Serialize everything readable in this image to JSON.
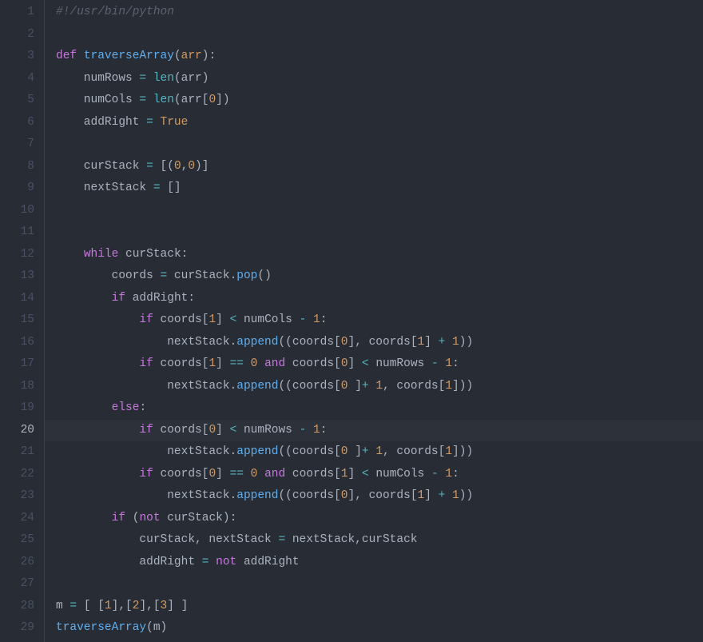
{
  "editor": {
    "active_line": 20,
    "lines": [
      {
        "n": 1,
        "tokens": [
          [
            "c-comment",
            "#!/usr/bin/python"
          ]
        ]
      },
      {
        "n": 2,
        "tokens": []
      },
      {
        "n": 3,
        "tokens": [
          [
            "c-keyword",
            "def"
          ],
          [
            "c-ident",
            " "
          ],
          [
            "c-def",
            "traverseArray"
          ],
          [
            "c-punc",
            "("
          ],
          [
            "c-param",
            "arr"
          ],
          [
            "c-punc",
            ")"
          ],
          [
            "c-punc",
            ":"
          ]
        ]
      },
      {
        "n": 4,
        "tokens": [
          [
            "c-ident",
            "    numRows "
          ],
          [
            "c-op",
            "="
          ],
          [
            "c-ident",
            " "
          ],
          [
            "c-builtin",
            "len"
          ],
          [
            "c-punc",
            "("
          ],
          [
            "c-ident",
            "arr"
          ],
          [
            "c-punc",
            ")"
          ]
        ]
      },
      {
        "n": 5,
        "tokens": [
          [
            "c-ident",
            "    numCols "
          ],
          [
            "c-op",
            "="
          ],
          [
            "c-ident",
            " "
          ],
          [
            "c-builtin",
            "len"
          ],
          [
            "c-punc",
            "("
          ],
          [
            "c-ident",
            "arr"
          ],
          [
            "c-punc",
            "["
          ],
          [
            "c-num",
            "0"
          ],
          [
            "c-punc",
            "]"
          ],
          [
            "c-punc",
            ")"
          ]
        ]
      },
      {
        "n": 6,
        "tokens": [
          [
            "c-ident",
            "    addRight "
          ],
          [
            "c-op",
            "="
          ],
          [
            "c-ident",
            " "
          ],
          [
            "c-bool",
            "True"
          ]
        ]
      },
      {
        "n": 7,
        "tokens": []
      },
      {
        "n": 8,
        "tokens": [
          [
            "c-ident",
            "    curStack "
          ],
          [
            "c-op",
            "="
          ],
          [
            "c-ident",
            " "
          ],
          [
            "c-punc",
            "[("
          ],
          [
            "c-num",
            "0"
          ],
          [
            "c-punc",
            ","
          ],
          [
            "c-num",
            "0"
          ],
          [
            "c-punc",
            ")]"
          ]
        ]
      },
      {
        "n": 9,
        "tokens": [
          [
            "c-ident",
            "    nextStack "
          ],
          [
            "c-op",
            "="
          ],
          [
            "c-ident",
            " "
          ],
          [
            "c-punc",
            "[]"
          ]
        ]
      },
      {
        "n": 10,
        "tokens": []
      },
      {
        "n": 11,
        "tokens": []
      },
      {
        "n": 12,
        "tokens": [
          [
            "c-ident",
            "    "
          ],
          [
            "c-keyword",
            "while"
          ],
          [
            "c-ident",
            " curStack"
          ],
          [
            "c-punc",
            ":"
          ]
        ]
      },
      {
        "n": 13,
        "tokens": [
          [
            "c-ident",
            "        coords "
          ],
          [
            "c-op",
            "="
          ],
          [
            "c-ident",
            " curStack"
          ],
          [
            "c-punc",
            "."
          ],
          [
            "c-func",
            "pop"
          ],
          [
            "c-punc",
            "()"
          ]
        ]
      },
      {
        "n": 14,
        "tokens": [
          [
            "c-ident",
            "        "
          ],
          [
            "c-keyword",
            "if"
          ],
          [
            "c-ident",
            " addRight"
          ],
          [
            "c-punc",
            ":"
          ]
        ]
      },
      {
        "n": 15,
        "tokens": [
          [
            "c-ident",
            "            "
          ],
          [
            "c-keyword",
            "if"
          ],
          [
            "c-ident",
            " coords"
          ],
          [
            "c-punc",
            "["
          ],
          [
            "c-num",
            "1"
          ],
          [
            "c-punc",
            "]"
          ],
          [
            "c-ident",
            " "
          ],
          [
            "c-op",
            "<"
          ],
          [
            "c-ident",
            " numCols "
          ],
          [
            "c-op",
            "-"
          ],
          [
            "c-ident",
            " "
          ],
          [
            "c-num",
            "1"
          ],
          [
            "c-punc",
            ":"
          ]
        ]
      },
      {
        "n": 16,
        "tokens": [
          [
            "c-ident",
            "                nextStack"
          ],
          [
            "c-punc",
            "."
          ],
          [
            "c-func",
            "append"
          ],
          [
            "c-punc",
            "(("
          ],
          [
            "c-ident",
            "coords"
          ],
          [
            "c-punc",
            "["
          ],
          [
            "c-num",
            "0"
          ],
          [
            "c-punc",
            "]"
          ],
          [
            "c-punc",
            ", "
          ],
          [
            "c-ident",
            "coords"
          ],
          [
            "c-punc",
            "["
          ],
          [
            "c-num",
            "1"
          ],
          [
            "c-punc",
            "]"
          ],
          [
            "c-ident",
            " "
          ],
          [
            "c-op",
            "+"
          ],
          [
            "c-ident",
            " "
          ],
          [
            "c-num",
            "1"
          ],
          [
            "c-punc",
            "))"
          ]
        ]
      },
      {
        "n": 17,
        "tokens": [
          [
            "c-ident",
            "            "
          ],
          [
            "c-keyword",
            "if"
          ],
          [
            "c-ident",
            " coords"
          ],
          [
            "c-punc",
            "["
          ],
          [
            "c-num",
            "1"
          ],
          [
            "c-punc",
            "]"
          ],
          [
            "c-ident",
            " "
          ],
          [
            "c-op",
            "=="
          ],
          [
            "c-ident",
            " "
          ],
          [
            "c-num",
            "0"
          ],
          [
            "c-ident",
            " "
          ],
          [
            "c-keyword",
            "and"
          ],
          [
            "c-ident",
            " coords"
          ],
          [
            "c-punc",
            "["
          ],
          [
            "c-num",
            "0"
          ],
          [
            "c-punc",
            "]"
          ],
          [
            "c-ident",
            " "
          ],
          [
            "c-op",
            "<"
          ],
          [
            "c-ident",
            " numRows "
          ],
          [
            "c-op",
            "-"
          ],
          [
            "c-ident",
            " "
          ],
          [
            "c-num",
            "1"
          ],
          [
            "c-punc",
            ":"
          ]
        ]
      },
      {
        "n": 18,
        "tokens": [
          [
            "c-ident",
            "                nextStack"
          ],
          [
            "c-punc",
            "."
          ],
          [
            "c-func",
            "append"
          ],
          [
            "c-punc",
            "(("
          ],
          [
            "c-ident",
            "coords"
          ],
          [
            "c-punc",
            "["
          ],
          [
            "c-num",
            "0"
          ],
          [
            "c-ident",
            " "
          ],
          [
            "c-punc",
            "]"
          ],
          [
            "c-op",
            "+"
          ],
          [
            "c-ident",
            " "
          ],
          [
            "c-num",
            "1"
          ],
          [
            "c-punc",
            ", "
          ],
          [
            "c-ident",
            "coords"
          ],
          [
            "c-punc",
            "["
          ],
          [
            "c-num",
            "1"
          ],
          [
            "c-punc",
            "]))"
          ]
        ]
      },
      {
        "n": 19,
        "tokens": [
          [
            "c-ident",
            "        "
          ],
          [
            "c-keyword",
            "else"
          ],
          [
            "c-punc",
            ":"
          ]
        ]
      },
      {
        "n": 20,
        "tokens": [
          [
            "c-ident",
            "            "
          ],
          [
            "c-keyword",
            "if"
          ],
          [
            "c-ident",
            " coords"
          ],
          [
            "c-punc",
            "["
          ],
          [
            "c-num",
            "0"
          ],
          [
            "c-punc",
            "]"
          ],
          [
            "c-ident",
            " "
          ],
          [
            "c-op",
            "<"
          ],
          [
            "c-ident",
            " numRows "
          ],
          [
            "c-op",
            "-"
          ],
          [
            "c-ident",
            " "
          ],
          [
            "c-num",
            "1"
          ],
          [
            "c-punc",
            ":"
          ]
        ]
      },
      {
        "n": 21,
        "tokens": [
          [
            "c-ident",
            "                nextStack"
          ],
          [
            "c-punc",
            "."
          ],
          [
            "c-func",
            "append"
          ],
          [
            "c-punc",
            "(("
          ],
          [
            "c-ident",
            "coords"
          ],
          [
            "c-punc",
            "["
          ],
          [
            "c-num",
            "0"
          ],
          [
            "c-ident",
            " "
          ],
          [
            "c-punc",
            "]"
          ],
          [
            "c-op",
            "+"
          ],
          [
            "c-ident",
            " "
          ],
          [
            "c-num",
            "1"
          ],
          [
            "c-punc",
            ", "
          ],
          [
            "c-ident",
            "coords"
          ],
          [
            "c-punc",
            "["
          ],
          [
            "c-num",
            "1"
          ],
          [
            "c-punc",
            "]))"
          ]
        ]
      },
      {
        "n": 22,
        "tokens": [
          [
            "c-ident",
            "            "
          ],
          [
            "c-keyword",
            "if"
          ],
          [
            "c-ident",
            " coords"
          ],
          [
            "c-punc",
            "["
          ],
          [
            "c-num",
            "0"
          ],
          [
            "c-punc",
            "]"
          ],
          [
            "c-ident",
            " "
          ],
          [
            "c-op",
            "=="
          ],
          [
            "c-ident",
            " "
          ],
          [
            "c-num",
            "0"
          ],
          [
            "c-ident",
            " "
          ],
          [
            "c-keyword",
            "and"
          ],
          [
            "c-ident",
            " coords"
          ],
          [
            "c-punc",
            "["
          ],
          [
            "c-num",
            "1"
          ],
          [
            "c-punc",
            "]"
          ],
          [
            "c-ident",
            " "
          ],
          [
            "c-op",
            "<"
          ],
          [
            "c-ident",
            " numCols "
          ],
          [
            "c-op",
            "-"
          ],
          [
            "c-ident",
            " "
          ],
          [
            "c-num",
            "1"
          ],
          [
            "c-punc",
            ":"
          ]
        ]
      },
      {
        "n": 23,
        "tokens": [
          [
            "c-ident",
            "                nextStack"
          ],
          [
            "c-punc",
            "."
          ],
          [
            "c-func",
            "append"
          ],
          [
            "c-punc",
            "(("
          ],
          [
            "c-ident",
            "coords"
          ],
          [
            "c-punc",
            "["
          ],
          [
            "c-num",
            "0"
          ],
          [
            "c-punc",
            "]"
          ],
          [
            "c-punc",
            ", "
          ],
          [
            "c-ident",
            "coords"
          ],
          [
            "c-punc",
            "["
          ],
          [
            "c-num",
            "1"
          ],
          [
            "c-punc",
            "]"
          ],
          [
            "c-ident",
            " "
          ],
          [
            "c-op",
            "+"
          ],
          [
            "c-ident",
            " "
          ],
          [
            "c-num",
            "1"
          ],
          [
            "c-punc",
            "))"
          ]
        ]
      },
      {
        "n": 24,
        "tokens": [
          [
            "c-ident",
            "        "
          ],
          [
            "c-keyword",
            "if"
          ],
          [
            "c-ident",
            " "
          ],
          [
            "c-punc",
            "("
          ],
          [
            "c-keyword",
            "not"
          ],
          [
            "c-ident",
            " curStack"
          ],
          [
            "c-punc",
            ")"
          ],
          [
            "c-punc",
            ":"
          ]
        ]
      },
      {
        "n": 25,
        "tokens": [
          [
            "c-ident",
            "            curStack"
          ],
          [
            "c-punc",
            ","
          ],
          [
            "c-ident",
            " nextStack "
          ],
          [
            "c-op",
            "="
          ],
          [
            "c-ident",
            " nextStack"
          ],
          [
            "c-punc",
            ","
          ],
          [
            "c-ident",
            "curStack"
          ]
        ]
      },
      {
        "n": 26,
        "tokens": [
          [
            "c-ident",
            "            addRight "
          ],
          [
            "c-op",
            "="
          ],
          [
            "c-ident",
            " "
          ],
          [
            "c-keyword",
            "not"
          ],
          [
            "c-ident",
            " addRight"
          ]
        ]
      },
      {
        "n": 27,
        "tokens": []
      },
      {
        "n": 28,
        "tokens": [
          [
            "c-ident",
            "m "
          ],
          [
            "c-op",
            "="
          ],
          [
            "c-ident",
            " "
          ],
          [
            "c-punc",
            "[ ["
          ],
          [
            "c-num",
            "1"
          ],
          [
            "c-punc",
            "],["
          ],
          [
            "c-num",
            "2"
          ],
          [
            "c-punc",
            "],["
          ],
          [
            "c-num",
            "3"
          ],
          [
            "c-punc",
            "] ]"
          ]
        ]
      },
      {
        "n": 29,
        "tokens": [
          [
            "c-func",
            "traverseArray"
          ],
          [
            "c-punc",
            "("
          ],
          [
            "c-ident",
            "m"
          ],
          [
            "c-punc",
            ")"
          ]
        ]
      }
    ]
  }
}
